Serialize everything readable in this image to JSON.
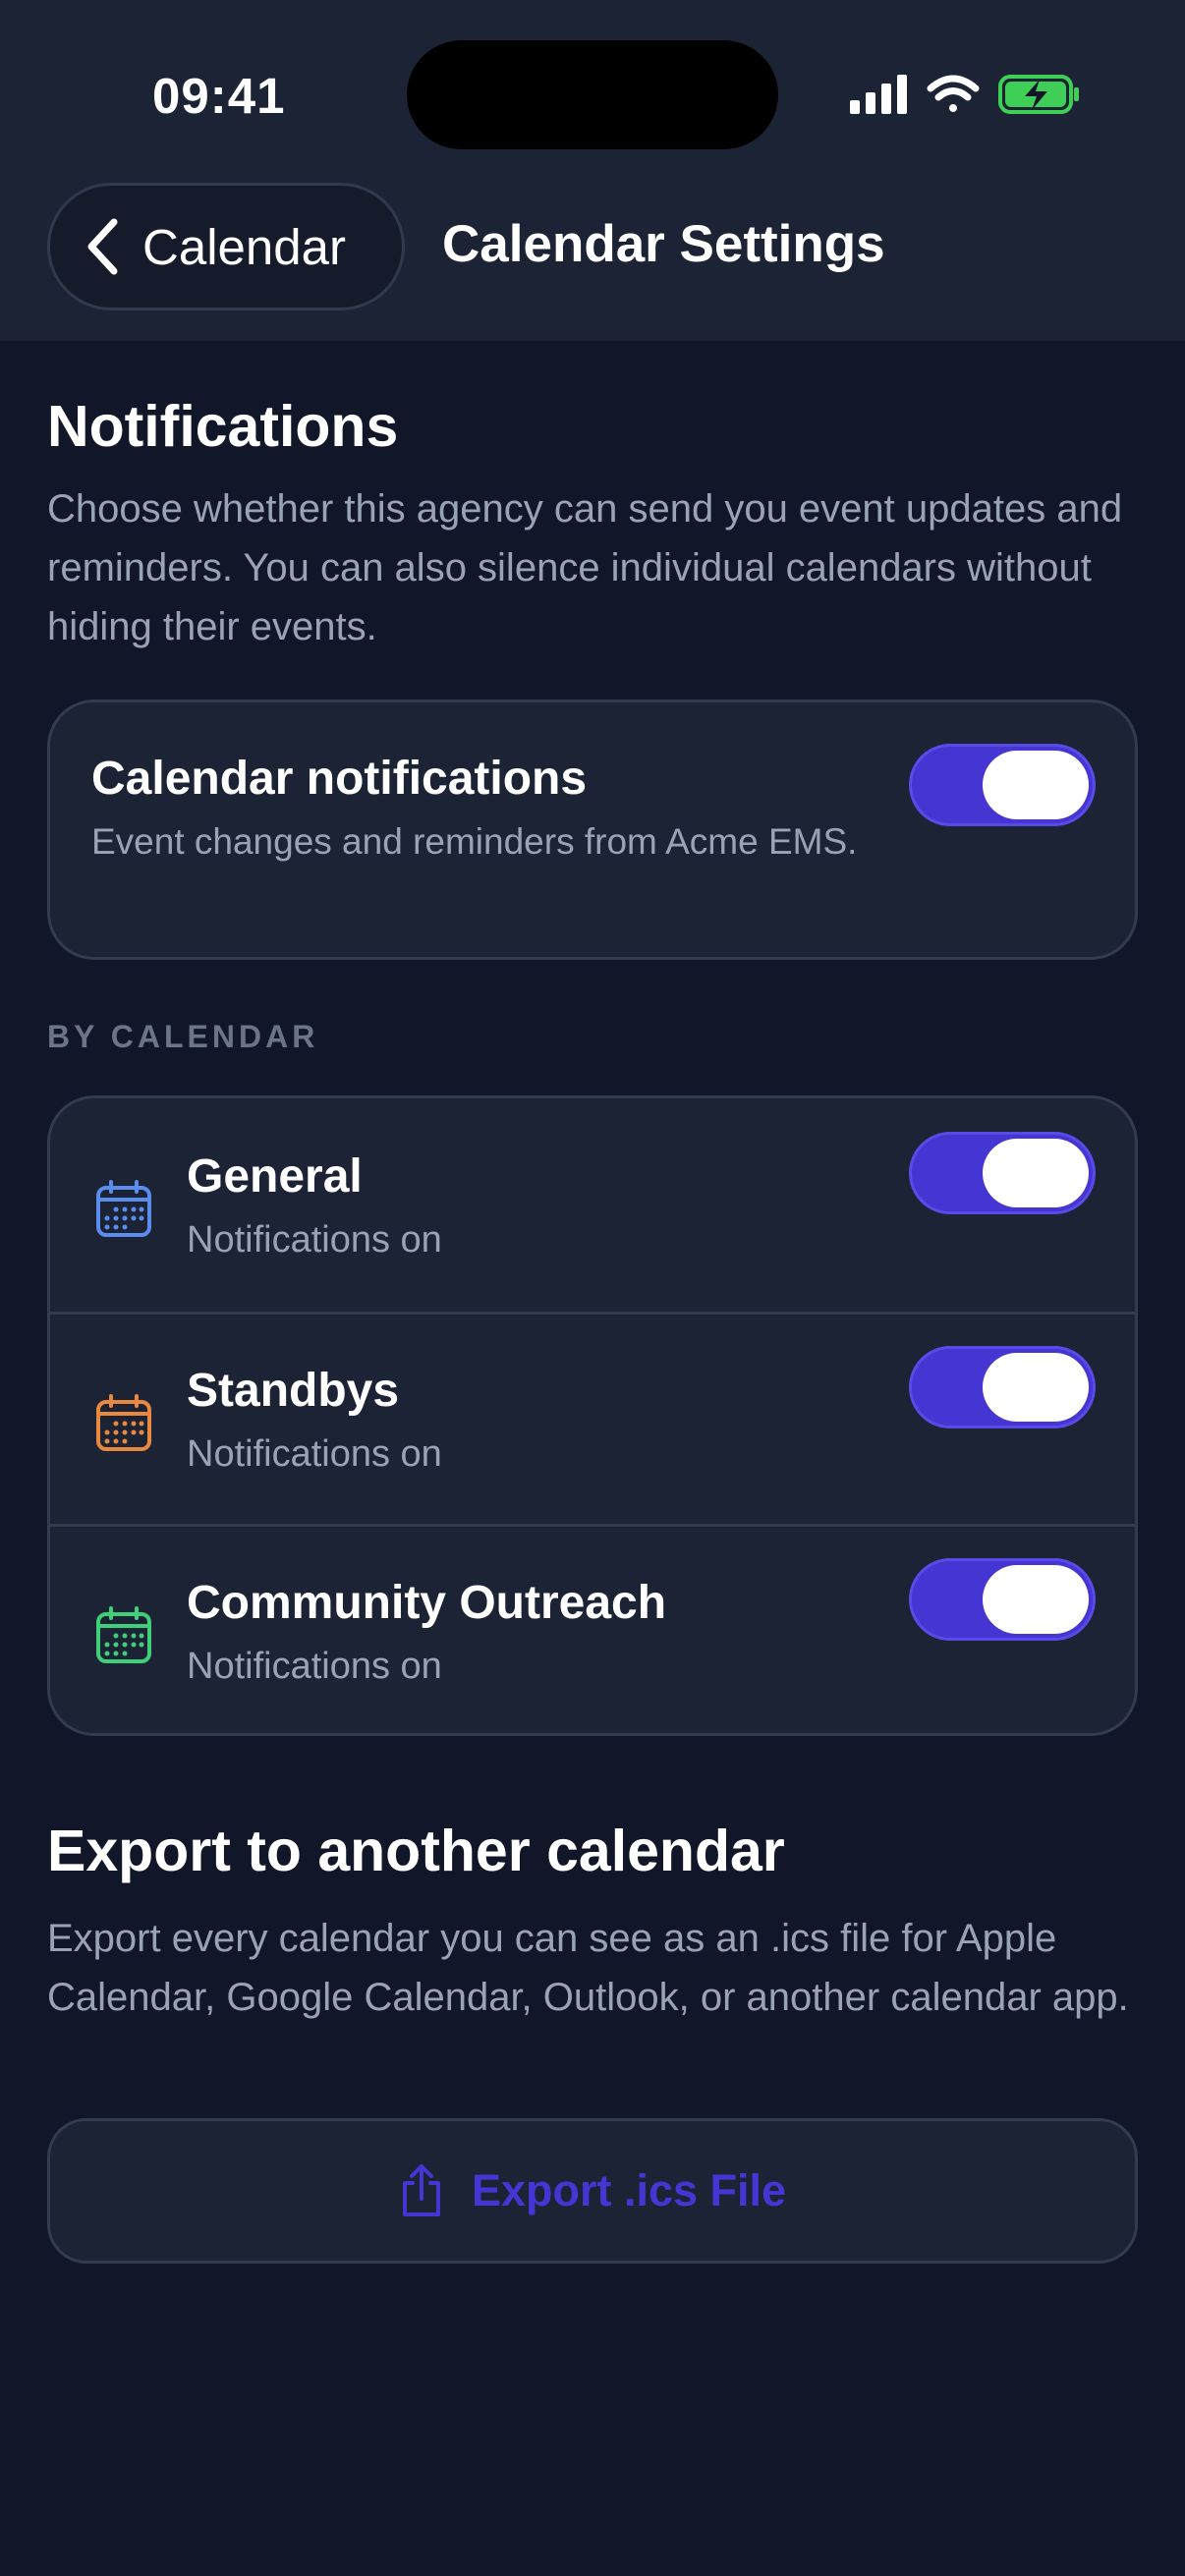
{
  "status_bar": {
    "time": "09:41"
  },
  "header": {
    "back_label": "Calendar",
    "title": "Calendar Settings"
  },
  "notifications": {
    "heading": "Notifications",
    "description": "Choose whether this agency can send you event updates and reminders. You can also silence individual calendars without hiding their events.",
    "master": {
      "title": "Calendar notifications",
      "subtitle": "Event changes and reminders from Acme EMS.",
      "enabled": true
    }
  },
  "by_calendar": {
    "label": "BY CALENDAR",
    "items": [
      {
        "name": "General",
        "status": "Notifications on",
        "enabled": true,
        "color": "#5b8def",
        "icon": "calendar-icon"
      },
      {
        "name": "Standbys",
        "status": "Notifications on",
        "enabled": true,
        "color": "#e8893f",
        "icon": "calendar-icon"
      },
      {
        "name": "Community Outreach",
        "status": "Notifications on",
        "enabled": true,
        "color": "#3fcf78",
        "icon": "calendar-icon"
      }
    ]
  },
  "export": {
    "heading": "Export to another calendar",
    "description": "Export every calendar you can see as an .ics file for Apple Calendar, Google Calendar, Outlook, or another calendar app.",
    "button_label": "Export .ics File",
    "button_icon": "share-icon"
  },
  "colors": {
    "accent": "#4535d3",
    "background": "#111729",
    "card": "#1c2335"
  }
}
